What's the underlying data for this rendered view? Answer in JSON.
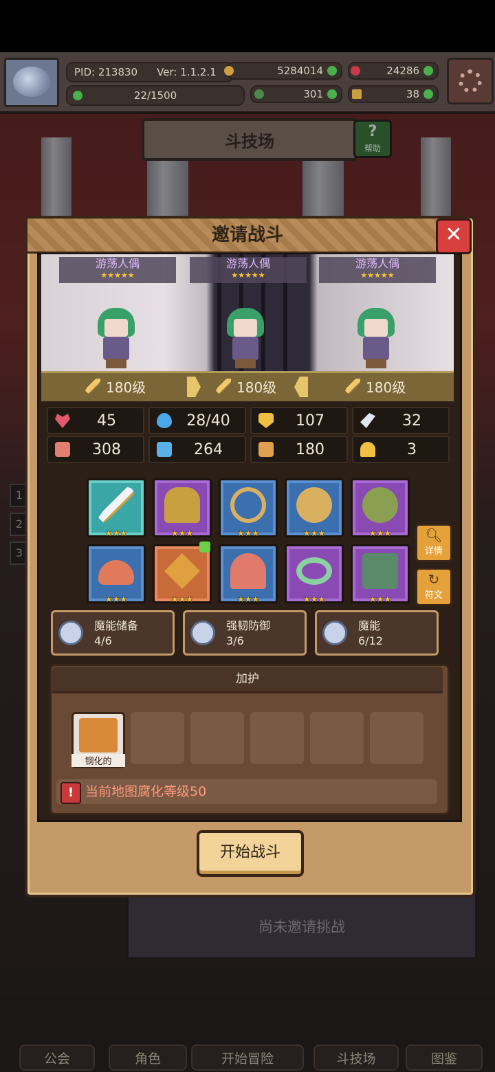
{
  "topbar": {
    "pid": "PID: 213830",
    "version": "Ver: 1.1.2.1",
    "gold": "5284014",
    "gems": "24286",
    "stamina": "22/1500",
    "clover": "301",
    "keys": "38"
  },
  "arena": {
    "title": "斗技场",
    "help_label": "帮助",
    "not_invited": "尚未邀请挑战"
  },
  "modal": {
    "title": "邀请战斗",
    "close_symbol": "✕",
    "characters": [
      {
        "name": "游荡人偶",
        "stars": "★★★★★",
        "level": "180级"
      },
      {
        "name": "游荡人偶",
        "stars": "★★★★★",
        "level": "180级"
      },
      {
        "name": "游荡人偶",
        "stars": "★★★★★",
        "level": "180级"
      }
    ],
    "stats": [
      {
        "icon": "heart-icon",
        "value": "45",
        "color": "#e05a6a"
      },
      {
        "icon": "mana-drop-icon",
        "value": "28/40",
        "color": "#4aa8e8"
      },
      {
        "icon": "shield-icon",
        "value": "107",
        "color": "#f0c040"
      },
      {
        "icon": "wing-icon",
        "value": "32",
        "color": "#e0e6f0"
      },
      {
        "icon": "fist-icon",
        "value": "308",
        "color": "#e08070"
      },
      {
        "icon": "book-icon",
        "value": "264",
        "color": "#5ab0e8"
      },
      {
        "icon": "scroll-icon",
        "value": "180",
        "color": "#e0a050"
      },
      {
        "icon": "horseshoe-icon",
        "value": "3",
        "color": "#f0c040"
      }
    ],
    "equipment": [
      {
        "icon": "sword-icon",
        "rarity": "teal",
        "stars": "★★★"
      },
      {
        "icon": "helmet-icon",
        "rarity": "purple",
        "stars": "★★★"
      },
      {
        "icon": "necklace-icon",
        "rarity": "blue",
        "stars": "★★★"
      },
      {
        "icon": "coin-shield-icon",
        "rarity": "blue",
        "stars": "★★★"
      },
      {
        "icon": "goblin-mask-icon",
        "rarity": "purple",
        "stars": "★★★"
      },
      {
        "icon": "bread-icon",
        "rarity": "blue",
        "stars": "★★★"
      },
      {
        "icon": "crossed-swords-icon",
        "rarity": "orange",
        "stars": "★★★"
      },
      {
        "icon": "mushroom-icon",
        "rarity": "blue",
        "stars": "★★★"
      },
      {
        "icon": "ring-icon",
        "rarity": "purple",
        "stars": "★★★"
      },
      {
        "icon": "boots-icon",
        "rarity": "purple",
        "stars": "★★★"
      }
    ],
    "detail_label": "详情",
    "rune_label": "符文",
    "traits": [
      {
        "name": "魔能储备",
        "value": "4/6"
      },
      {
        "name": "强韧防御",
        "value": "3/6"
      },
      {
        "name": "魔能",
        "value": "6/12"
      }
    ],
    "blessing_title": "加护",
    "blessing_item": "钢化的",
    "warning_symbol": "!",
    "warning_text": "当前地图腐化等级50",
    "start_button": "开始战斗"
  },
  "bottom_nav": [
    {
      "label": "公会"
    },
    {
      "label": "角色"
    },
    {
      "label": "开始冒险"
    },
    {
      "label": "斗技场"
    },
    {
      "label": "图鉴"
    }
  ],
  "side_tabs": [
    "1",
    "2",
    "3"
  ]
}
